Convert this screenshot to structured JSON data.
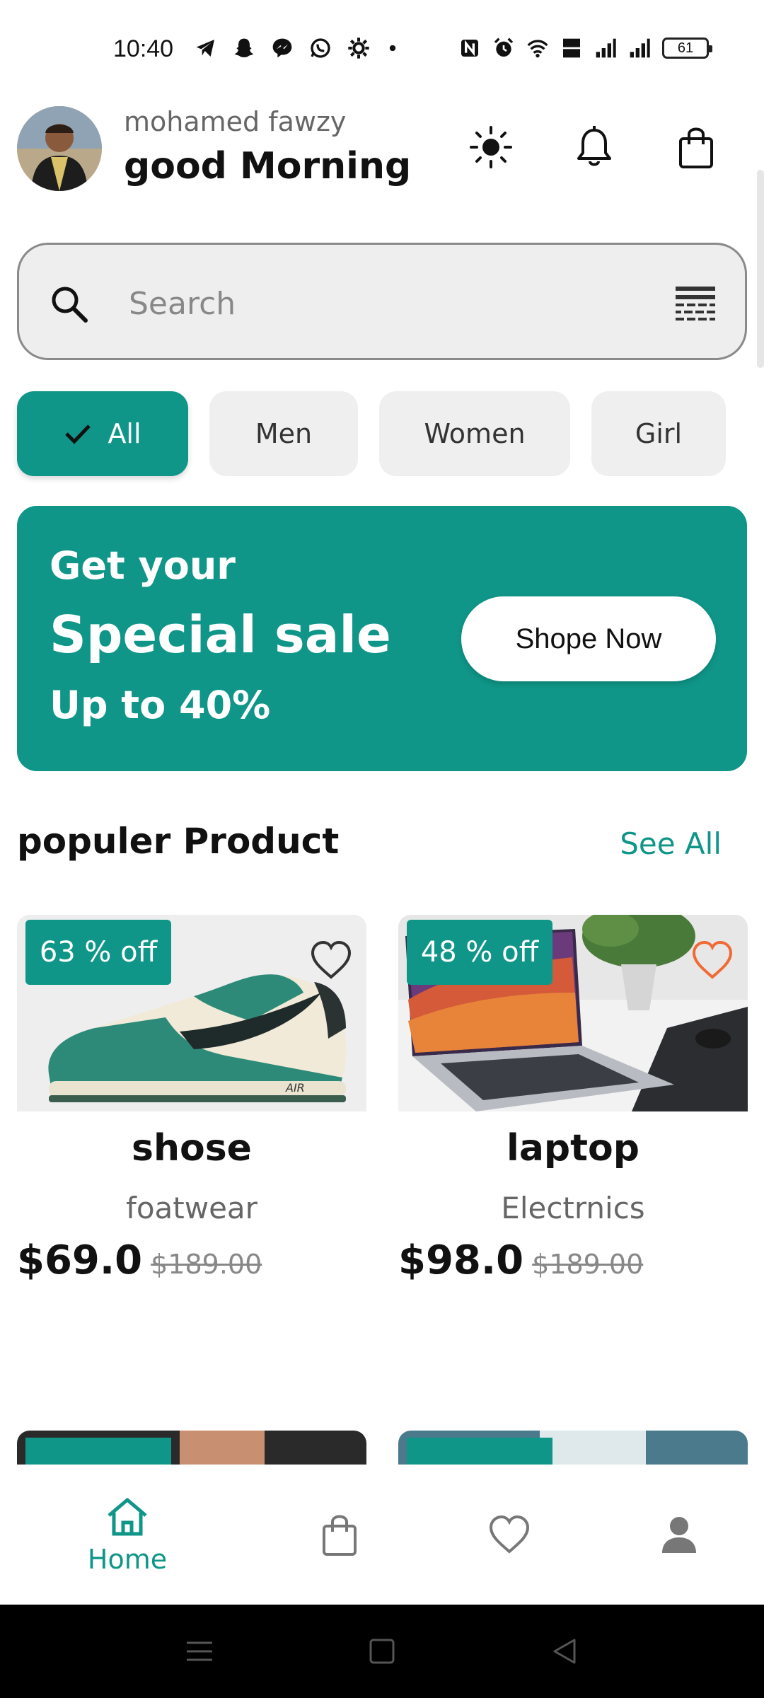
{
  "status_bar": {
    "time": "10:40",
    "battery": "61"
  },
  "header": {
    "user_name": "mohamed fawzy",
    "greeting": "good Morning"
  },
  "search": {
    "placeholder": "Search"
  },
  "chips": [
    {
      "label": "All",
      "selected": true
    },
    {
      "label": "Men",
      "selected": false
    },
    {
      "label": "Women",
      "selected": false
    },
    {
      "label": "Girl",
      "selected": false
    }
  ],
  "banner": {
    "line1": "Get your",
    "line2": "Special sale",
    "line3": "Up to 40%",
    "button": "Shope Now"
  },
  "section": {
    "title": "populer Product",
    "see_all": "See All"
  },
  "products": [
    {
      "discount": "63 % off",
      "name": "shose",
      "category": "foatwear",
      "price": "$69.0",
      "old_price": "$189.00",
      "favorited": false
    },
    {
      "discount": "48 % off",
      "name": "laptop",
      "category": "Electrnics",
      "price": "$98.0",
      "old_price": "$189.00",
      "favorited": true
    }
  ],
  "bottom_nav": {
    "home_label": "Home"
  },
  "colors": {
    "accent": "#0f9688",
    "favorite": "#f06a35"
  }
}
